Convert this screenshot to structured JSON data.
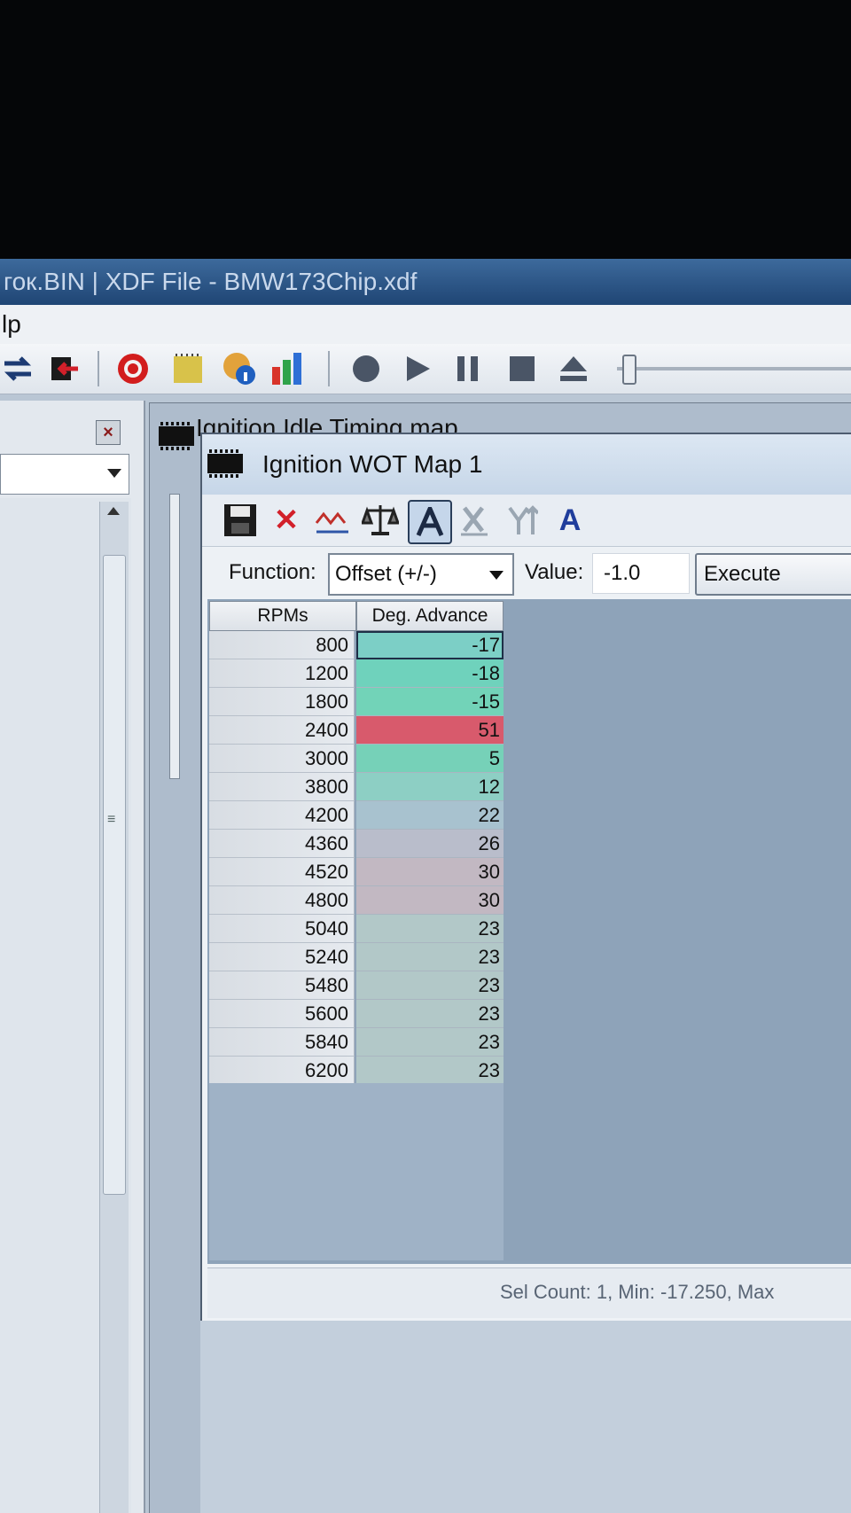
{
  "app": {
    "title": "гок.BIN | XDF File - BMW173Chip.xdf",
    "menu_partial": "lp"
  },
  "toolbar_icons": [
    "swap-arrows-icon",
    "import-chip-icon",
    "target-icon",
    "notepad-icon",
    "info-globe-icon",
    "bar-chart-icon",
    "record-icon",
    "play-icon",
    "pause-icon",
    "stop-icon",
    "eject-icon",
    "slider"
  ],
  "background_window": {
    "title": "Ignition Idle Timing map"
  },
  "map_window": {
    "title": "Ignition WOT Map 1",
    "tools": [
      "save-icon",
      "delete-icon",
      "graph-icon",
      "compare-scale-icon",
      "axis-text-icon",
      "x-axis-icon",
      "y-axis-icon",
      "text-icon"
    ],
    "function_label": "Function:",
    "function_value": "Offset (+/-)",
    "value_label": "Value:",
    "value": "-1.0",
    "execute_label": "Execute",
    "table": {
      "headers": [
        "RPMs",
        "Deg. Advance"
      ],
      "rows": [
        {
          "rpm": "800",
          "deg": "-17",
          "color": "#7ccfc6"
        },
        {
          "rpm": "1200",
          "deg": "-18",
          "color": "#6fd2bc"
        },
        {
          "rpm": "1800",
          "deg": "-15",
          "color": "#72d3b8"
        },
        {
          "rpm": "2400",
          "deg": "51",
          "color": "#d85a6c"
        },
        {
          "rpm": "3000",
          "deg": "5",
          "color": "#76d1b8"
        },
        {
          "rpm": "3800",
          "deg": "12",
          "color": "#8dcfc4"
        },
        {
          "rpm": "4200",
          "deg": "22",
          "color": "#a8c2cf"
        },
        {
          "rpm": "4360",
          "deg": "26",
          "color": "#b9bdcb"
        },
        {
          "rpm": "4520",
          "deg": "30",
          "color": "#c2b8c2"
        },
        {
          "rpm": "4800",
          "deg": "30",
          "color": "#c2b8c2"
        },
        {
          "rpm": "5040",
          "deg": "23",
          "color": "#b2c8c8"
        },
        {
          "rpm": "5240",
          "deg": "23",
          "color": "#b2c8c8"
        },
        {
          "rpm": "5480",
          "deg": "23",
          "color": "#b2c8c8"
        },
        {
          "rpm": "5600",
          "deg": "23",
          "color": "#b2c8c8"
        },
        {
          "rpm": "5840",
          "deg": "23",
          "color": "#b2c8c8"
        },
        {
          "rpm": "6200",
          "deg": "23",
          "color": "#b2c8c8"
        }
      ]
    },
    "status": "Sel Count: 1, Min: -17.250, Max"
  }
}
